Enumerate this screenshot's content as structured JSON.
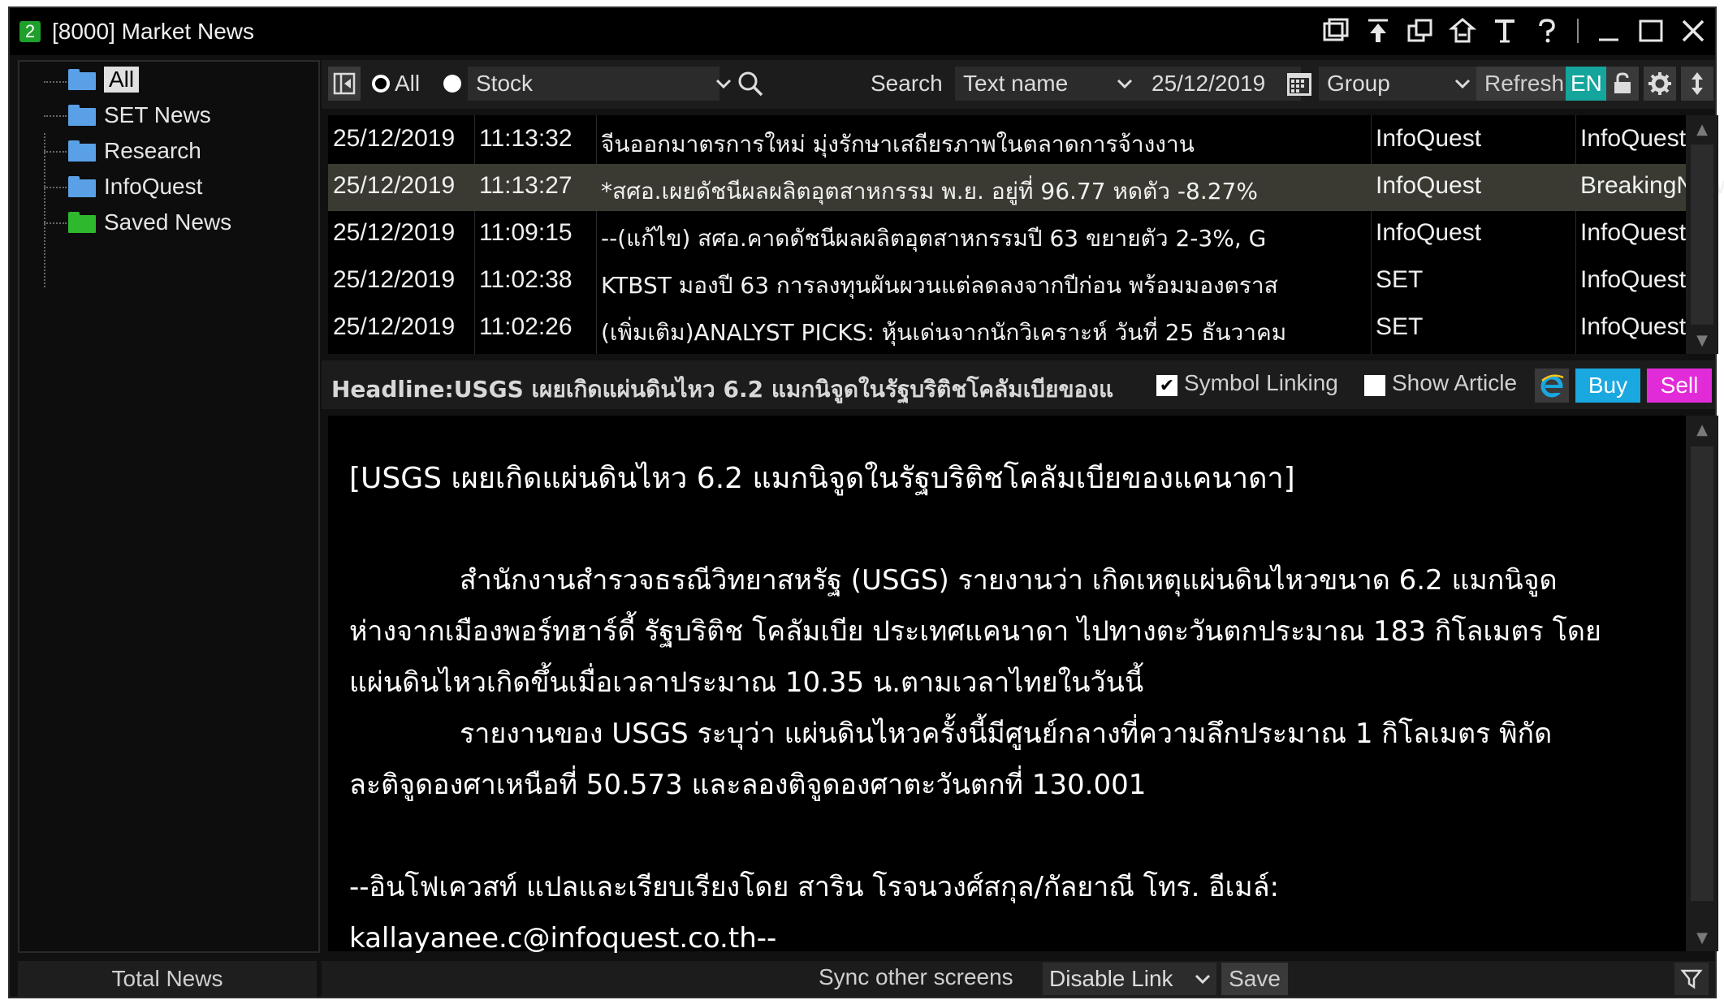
{
  "window": {
    "number": "2",
    "title": "[8000] Market News"
  },
  "colors": {
    "accent_green": "#1fa02b",
    "en_button": "#14a59c",
    "buy_button": "#1aa8e0",
    "sell_button": "#e22bd8",
    "selected_row": "#3a3a32",
    "folder_blue": "#5aa0e6",
    "folder_green": "#2eb82e"
  },
  "title_icons": [
    "restore-window-icon",
    "pin-top-icon",
    "duplicate-window-icon",
    "share-icon",
    "font-icon",
    "help-icon",
    "minimize-icon",
    "maximize-icon",
    "close-icon"
  ],
  "tree": [
    {
      "label": "All",
      "icon": "folder-blue-icon",
      "selected": true
    },
    {
      "label": "SET News",
      "icon": "folder-blue-icon"
    },
    {
      "label": "Research",
      "icon": "folder-blue-icon"
    },
    {
      "label": "InfoQuest",
      "icon": "folder-blue-icon"
    },
    {
      "label": "Saved News",
      "icon": "folder-green-icon"
    }
  ],
  "left_footer": "Total News",
  "toolbar": {
    "radio_all": "All",
    "radio_stock": "Stock",
    "search_label": "Search",
    "search_type": "Text name",
    "date": "25/12/2019",
    "group": "Group",
    "refresh": "Refresh",
    "lang": "EN"
  },
  "news": [
    {
      "date": "25/12/2019",
      "time": "11:13:32",
      "headline": "จีนออกมาตรการใหม่ มุ่งรักษาเสถียรภาพในตลาดการจ้างงาน",
      "source": "InfoQuest",
      "category": "InfoQuest"
    },
    {
      "date": "25/12/2019",
      "time": "11:13:27",
      "headline": "*สศอ.เผยดัชนีผลผลิตอุตสาหกรรม พ.ย. อยู่ที่ 96.77 หดตัว -8.27%",
      "source": "InfoQuest",
      "category": "BreakingNew",
      "selected": true
    },
    {
      "date": "25/12/2019",
      "time": "11:09:15",
      "headline": "--(แก้ไข) สศอ.คาดดัชนีผลผลิตอุตสาหกรรมปี 63 ขยายตัว 2-3%, G",
      "source": "InfoQuest",
      "category": "InfoQuest"
    },
    {
      "date": "25/12/2019",
      "time": "11:02:38",
      "headline": "KTBST มองปี 63 การลงทุนผันผวนแต่ลดลงจากปีก่อน พร้อมมองตราส",
      "source": "SET",
      "category": "InfoQuest"
    },
    {
      "date": "25/12/2019",
      "time": "11:02:26",
      "headline": "(เพิ่มเติม)ANALYST PICKS: หุ้นเด่นจากนักวิเคราะห์ วันที่ 25 ธันวาคม",
      "source": "SET",
      "category": "InfoQuest"
    }
  ],
  "headline_bar": {
    "label": "Headline:",
    "text": "USGS เผยเกิดแผ่นดินไหว 6.2 แมกนิจูดในรัฐบริติชโคลัมเบียของแ",
    "symbol_linking": "Symbol Linking",
    "show_article": "Show Article",
    "buy": "Buy",
    "sell": "Sell"
  },
  "article": {
    "title": "[USGS เผยเกิดแผ่นดินไหว 6.2 แมกนิจูดในรัฐบริติชโคลัมเบียของแคนาดา]",
    "para1_first": "สำนักงานสำรวจธรณีวิทยาสหรัฐ (USGS) รายงานว่า เกิดเหตุแผ่นดินไหวขนาด 6.2 แมกนิจูด",
    "para1_rest": "ห่างจากเมืองพอร์ทฮาร์ดี้ รัฐบริติช โคลัมเบีย ประเทศแคนาดา ไปทางตะวันตกประมาณ 183 กิโลเมตร โดยแผ่นดินไหวเกิดขึ้นเมื่อเวลาประมาณ 10.35 น.ตามเวลาไทยในวันนี้",
    "para2_first": "รายงานของ USGS ระบุว่า แผ่นดินไหวครั้งนี้มีศูนย์กลางที่ความลึกประมาณ 1 กิโลเมตร พิกัด",
    "para2_rest": "ละติจูดองศาเหนือที่ 50.573 และลองติจูดองศาตะวันตกที่ 130.001",
    "footer1": "--อินโฟเควสท์ แปลและเรียบเรียงโดย สาริน โรจนวงศ์สกุล/กัลยาณี โทร. อีเมล์:",
    "footer2": "kallayanee.c@infoquest.co.th--"
  },
  "bottom": {
    "sync_label": "Sync other screens",
    "link_option": "Disable Link",
    "save": "Save"
  }
}
